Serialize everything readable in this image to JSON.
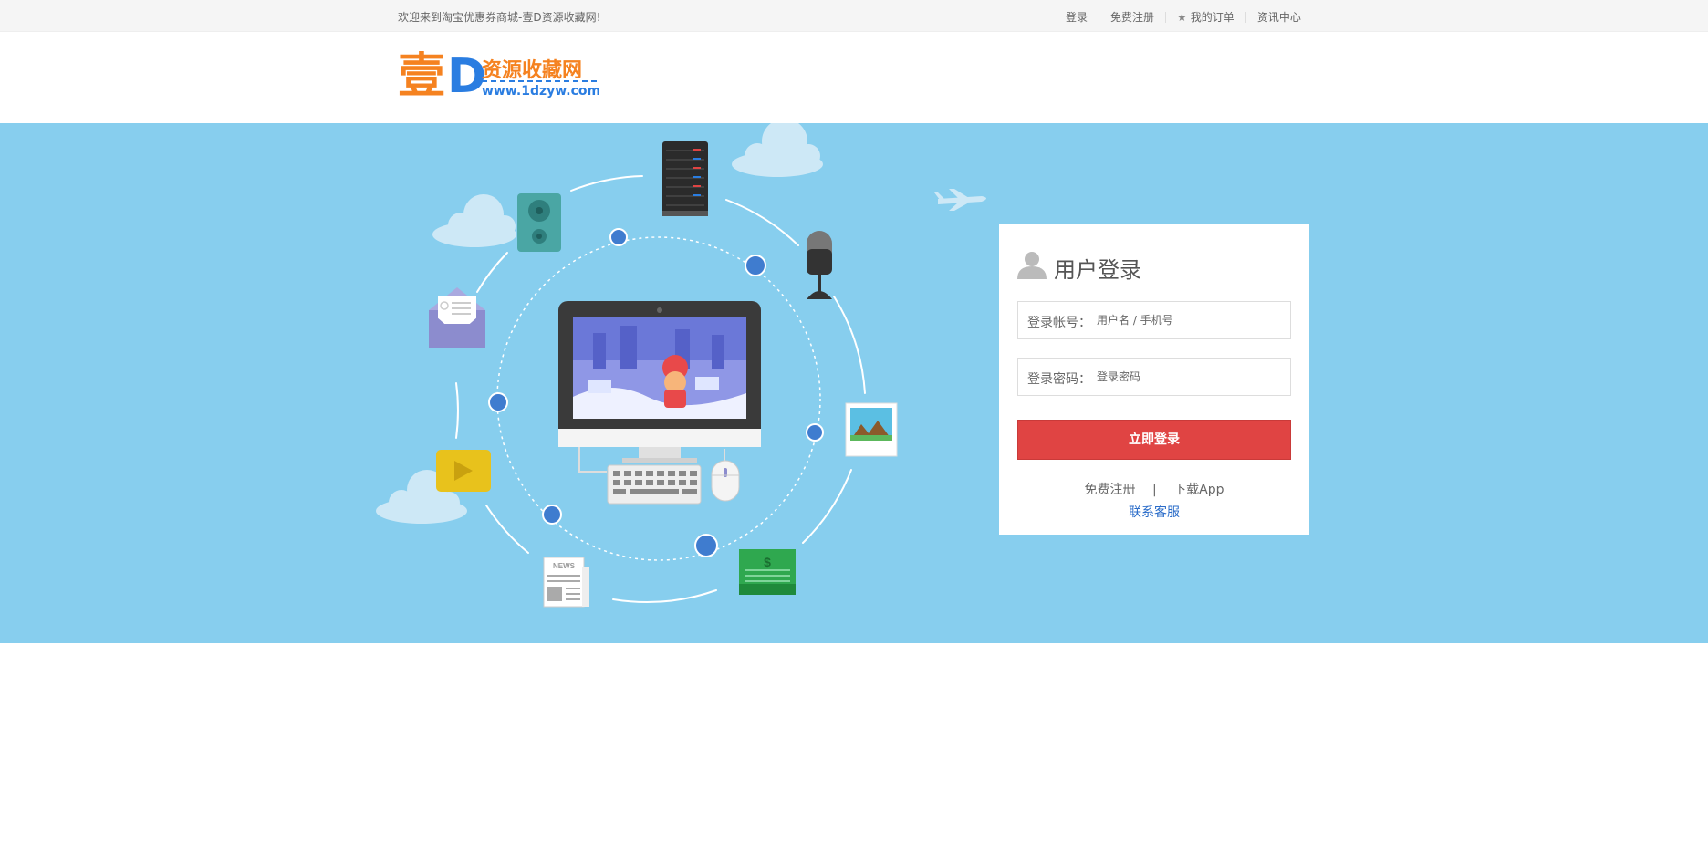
{
  "topbar": {
    "welcome": "欢迎来到淘宝优惠券商城-壹D资源收藏网!",
    "login": "登录",
    "register": "免费注册",
    "my_orders": "我的订单",
    "news": "资讯中心"
  },
  "logo": {
    "char": "壹",
    "letter": "D",
    "name": "资源收藏网",
    "url": "www.1dzyw.com"
  },
  "login_box": {
    "title": "用户登录",
    "account_label": "登录帐号：",
    "account_placeholder": "用户名 / 手机号",
    "password_label": "登录密码：",
    "password_placeholder": "登录密码",
    "submit": "立即登录",
    "register": "免费注册",
    "separator": "|",
    "download_app": "下载App",
    "contact": "联系客服"
  },
  "illustration": {
    "news_label": "NEWS",
    "money_symbol": "$"
  },
  "colors": {
    "banner": "#87ceee",
    "accent_orange": "#f58220",
    "accent_blue": "#2a7de1",
    "button_red": "#e04443"
  },
  "icons": [
    "user-icon",
    "star-icon",
    "server-icon",
    "speaker-icon",
    "microphone-icon",
    "envelope-icon",
    "image-icon",
    "play-icon",
    "news-icon",
    "money-icon",
    "computer-icon",
    "keyboard-icon",
    "mouse-icon",
    "cloud-icon",
    "airplane-icon"
  ]
}
